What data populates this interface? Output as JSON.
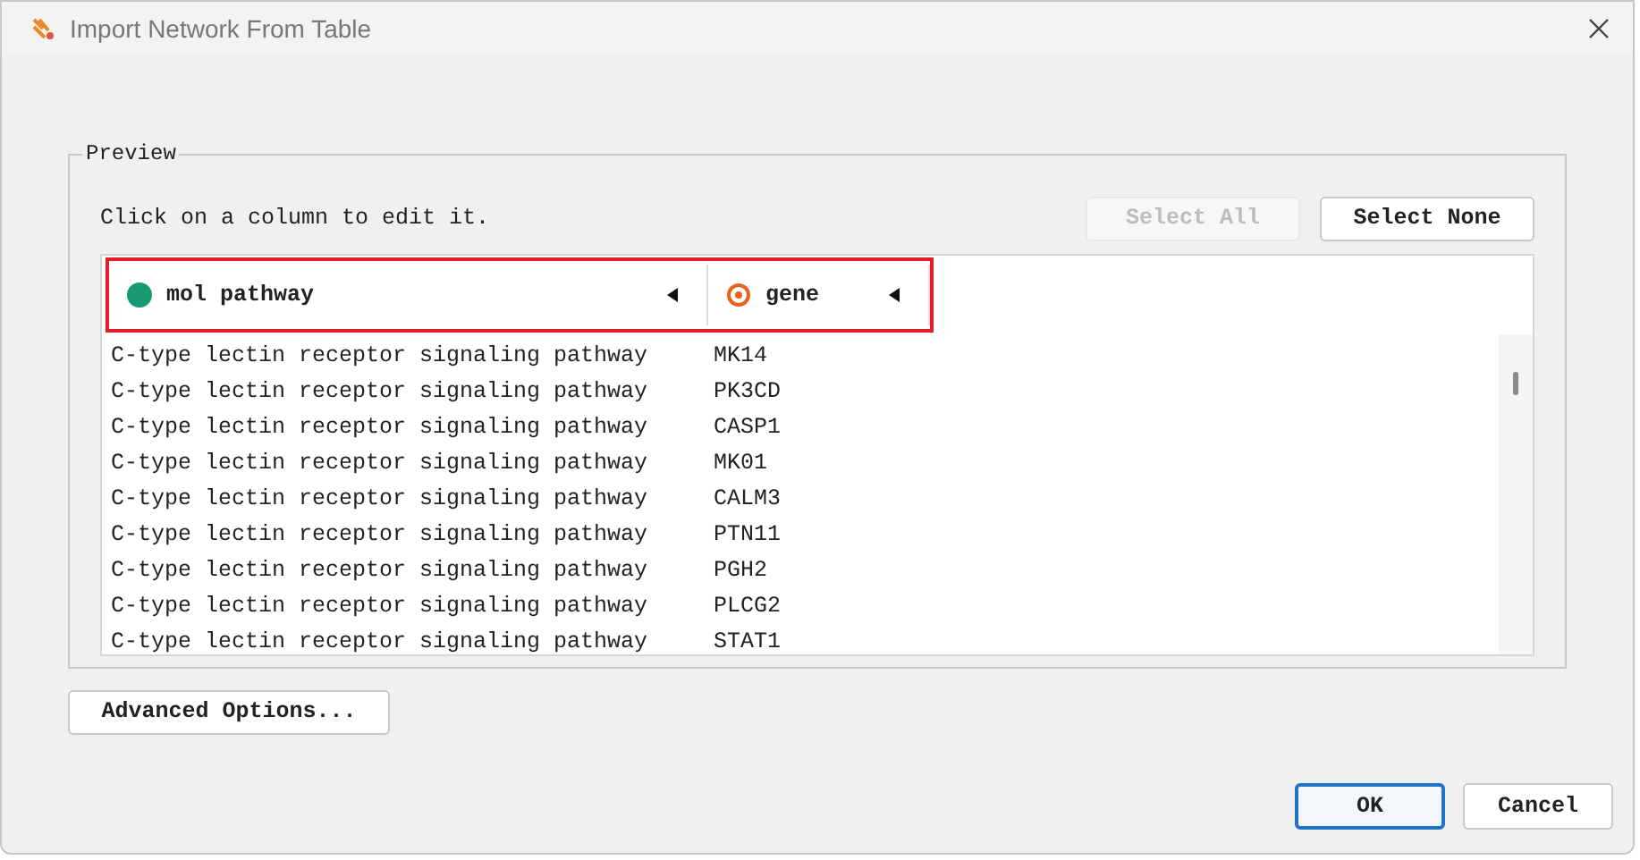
{
  "window": {
    "title": "Import Network From Table"
  },
  "preview": {
    "legend": "Preview",
    "hint": "Click on a column to edit it.",
    "buttons": [
      {
        "label": "Select All",
        "disabled": true
      },
      {
        "label": "Select None",
        "disabled": false
      }
    ],
    "columns": [
      {
        "name": "mol pathway",
        "kind": "source"
      },
      {
        "name": "gene",
        "kind": "target"
      }
    ],
    "rows": [
      [
        "C-type lectin receptor signaling pathway",
        "MK14"
      ],
      [
        "C-type lectin receptor signaling pathway",
        "PK3CD"
      ],
      [
        "C-type lectin receptor signaling pathway",
        "CASP1"
      ],
      [
        "C-type lectin receptor signaling pathway",
        "MK01"
      ],
      [
        "C-type lectin receptor signaling pathway",
        "CALM3"
      ],
      [
        "C-type lectin receptor signaling pathway",
        "PTN11"
      ],
      [
        "C-type lectin receptor signaling pathway",
        "PGH2"
      ],
      [
        "C-type lectin receptor signaling pathway",
        "PLCG2"
      ],
      [
        "C-type lectin receptor signaling pathway",
        "STAT1"
      ]
    ]
  },
  "advanced_button": "Advanced Options...",
  "footer_buttons": [
    {
      "label": "OK",
      "default": true
    },
    {
      "label": "Cancel",
      "default": false
    }
  ]
}
